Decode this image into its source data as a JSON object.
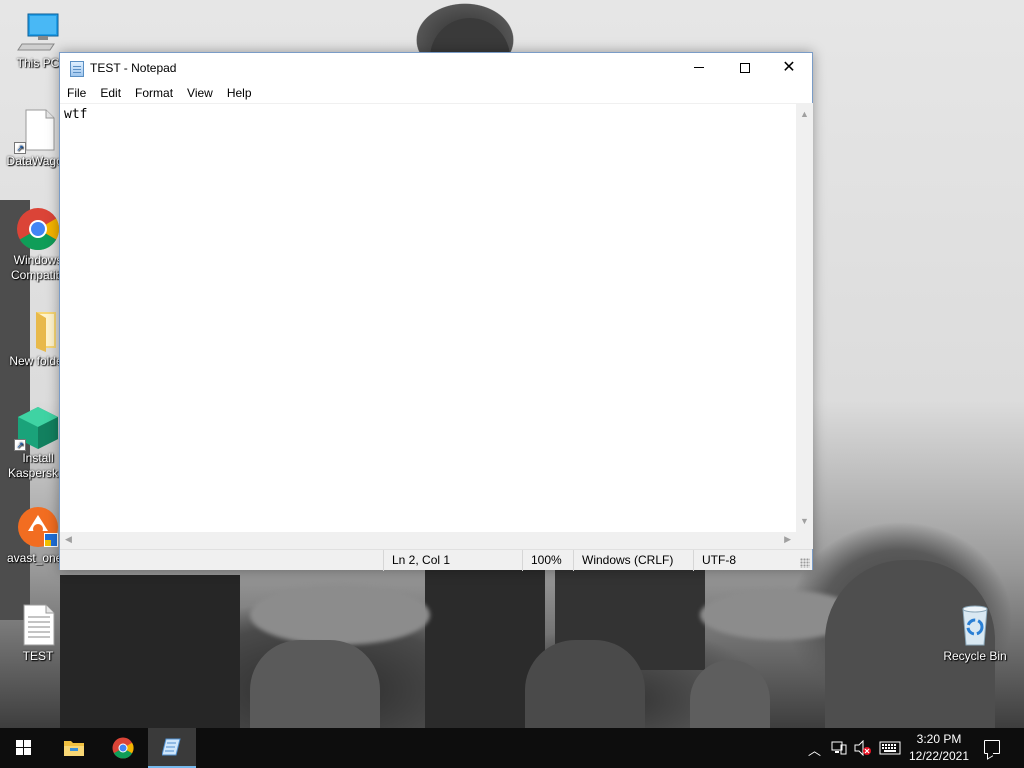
{
  "desktop": {
    "icons": [
      {
        "label": "This PC",
        "icon": "computer-icon"
      },
      {
        "label": "DataWagon",
        "icon": "file-shortcut-icon"
      },
      {
        "label": "Windows Compatibility",
        "line1": "Windows",
        "line2": "Compatibi",
        "icon": "chrome-icon"
      },
      {
        "label": "New folder",
        "icon": "folder-icon"
      },
      {
        "label": "Install Kaspersky",
        "line1": "Install",
        "line2": "Kaspersk...",
        "icon": "kaspersky-icon"
      },
      {
        "label": "avast_one_",
        "icon": "avast-icon"
      },
      {
        "label": "TEST",
        "icon": "text-file-icon"
      },
      {
        "label": "Recycle Bin",
        "icon": "recycle-bin-icon"
      }
    ]
  },
  "window": {
    "title": "TEST - Notepad",
    "menu": [
      "File",
      "Edit",
      "Format",
      "View",
      "Help"
    ],
    "content": "wtf",
    "status": {
      "position": "Ln 2, Col 1",
      "zoom": "100%",
      "line_ending": "Windows (CRLF)",
      "encoding": "UTF-8"
    }
  },
  "taskbar": {
    "pinned": [
      "start-icon",
      "file-explorer-icon",
      "chrome-icon",
      "notepad-icon"
    ],
    "clock_time": "3:20 PM",
    "clock_date": "12/22/2021",
    "accent": "#76b9ed"
  }
}
